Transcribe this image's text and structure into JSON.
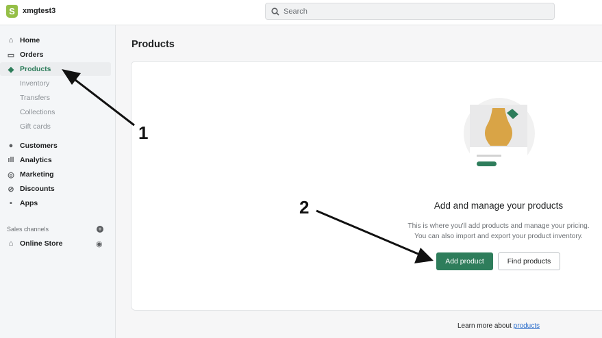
{
  "topbar": {
    "store_name": "xmgtest3",
    "search_placeholder": "Search"
  },
  "sidebar": {
    "items": [
      {
        "label": "Home",
        "icon": "home-icon"
      },
      {
        "label": "Orders",
        "icon": "inbox-icon"
      },
      {
        "label": "Products",
        "icon": "tag-icon"
      }
    ],
    "product_sub": [
      "Inventory",
      "Transfers",
      "Collections",
      "Gift cards"
    ],
    "items2": [
      {
        "label": "Customers",
        "icon": "person-icon"
      },
      {
        "label": "Analytics",
        "icon": "bar-chart-icon"
      },
      {
        "label": "Marketing",
        "icon": "target-icon"
      },
      {
        "label": "Discounts",
        "icon": "discount-icon"
      },
      {
        "label": "Apps",
        "icon": "apps-icon"
      }
    ],
    "sales_channels_label": "Sales channels",
    "online_store": "Online Store"
  },
  "main": {
    "page_title": "Products",
    "empty_title": "Add and manage your products",
    "empty_desc_1": "This is where you'll add products and manage your pricing.",
    "empty_desc_2": "You can also import and export your product inventory.",
    "add_product": "Add product",
    "find_products": "Find products",
    "learn_prefix": "Learn more about ",
    "learn_link": "products"
  },
  "annotations": {
    "one": "1",
    "two": "2"
  },
  "colors": {
    "accent": "#2e7d5b",
    "link": "#2c6ecb"
  }
}
